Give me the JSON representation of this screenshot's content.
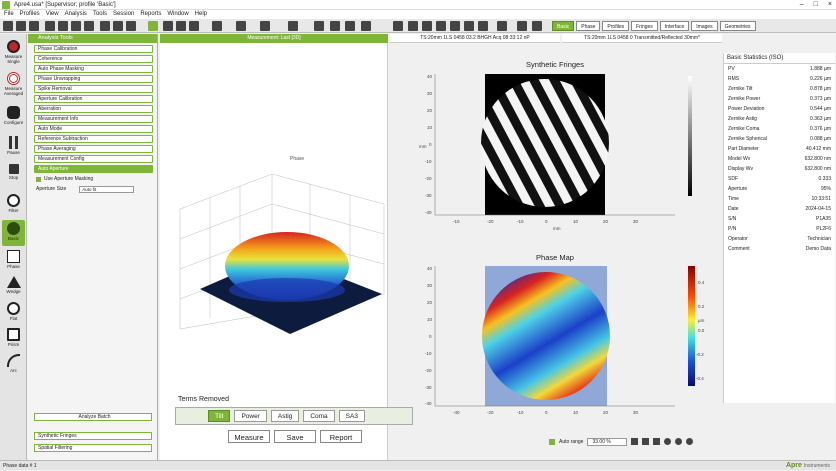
{
  "window": {
    "title": "Apre4.usa* [Supervisor; profile 'Basic']",
    "controls": [
      "–",
      "□",
      "×"
    ]
  },
  "menu": [
    "File",
    "Profiles",
    "View",
    "Analysis",
    "Tools",
    "Session",
    "Reports",
    "Window",
    "Help"
  ],
  "toolbar": {
    "view_tabs": [
      {
        "label": "Basic",
        "active": true
      },
      {
        "label": "Phase",
        "active": false
      },
      {
        "label": "Profiles",
        "active": false
      },
      {
        "label": "Fringes",
        "active": false
      },
      {
        "label": "Interface",
        "active": false
      },
      {
        "label": "Images",
        "active": false
      },
      {
        "label": "Geometries",
        "active": false
      }
    ]
  },
  "left_tools": [
    {
      "label": "Measure Single",
      "icon": "measure-circle-icon"
    },
    {
      "label": "Measure Averaged",
      "icon": "target-icon"
    },
    {
      "label": "Configure",
      "icon": "microphone-icon"
    },
    {
      "label": "Pause",
      "icon": "pause-icon"
    },
    {
      "label": "Stop",
      "icon": "stop-icon"
    },
    {
      "label": "Filter",
      "icon": "filter-wheel-icon"
    },
    {
      "label": "Basic",
      "icon": "basic-icon",
      "active": true
    },
    {
      "label": "Phase",
      "icon": "phase-icon"
    },
    {
      "label": "Wedge",
      "icon": "wedge-icon"
    },
    {
      "label": "Flat",
      "icon": "circle-icon"
    },
    {
      "label": "Prism",
      "icon": "prism-icon"
    },
    {
      "label": "Arc",
      "icon": "arc-icon"
    }
  ],
  "panel": {
    "header": "Analysis Tools",
    "items": [
      "Phase Calibration",
      "Coherence",
      "Auto Phase Masking",
      "Phase Unwrapping",
      "Spike Removal",
      "Aperture Calibration",
      "Aberration",
      "Measurement Info",
      "Auto Mode",
      "Reference Subtraction",
      "Phase Averaging",
      "Measurement Config",
      "Auto Aperture"
    ],
    "selected_index": 12,
    "sub_option": {
      "label": "Use Aperture Masking",
      "field_label": "Aperture Size",
      "field_value": "Auto fit"
    },
    "footer_top": "Analyze Batch",
    "footer_items": [
      "Synthetic Fringes",
      "Spatial Filtering"
    ]
  },
  "plot3d": {
    "tab": "Measurement: Last [3D]",
    "legend": "Phase"
  },
  "terms": {
    "label": "Terms Removed",
    "buttons": [
      "Tilt",
      "Power",
      "Astig",
      "Coma",
      "SA3"
    ],
    "selected": "Tilt"
  },
  "actions": {
    "measure": "Measure",
    "save": "Save",
    "report": "Report"
  },
  "fringes": {
    "header": "TS:20mm 1LS 0458 03.2 BHGH Acq 08:33:12 nP",
    "title": "Synthetic Fringes",
    "y_ticks": [
      "40",
      "30",
      "20",
      "10",
      "0",
      "-10",
      "-20",
      "-30",
      "-40"
    ],
    "x_ticks": [
      "-10",
      "-20",
      "-10",
      "0",
      "10",
      "20",
      "30"
    ],
    "y_label": "mm",
    "x_label": "mm"
  },
  "phase": {
    "header": "TS:20mm 1LS 0458 0 Transmitted/Reflected 30mm*",
    "title": "Phase Map",
    "colorbar_ticks": [
      "0.4",
      "0.2",
      "0.0",
      "-0.2",
      "-0.4"
    ],
    "colorbar_label": "µm",
    "y_ticks": [
      "40",
      "30",
      "20",
      "10",
      "0",
      "-10",
      "-20",
      "-30",
      "-40"
    ],
    "x_ticks": [
      "-40",
      "-20",
      "-10",
      "0",
      "10",
      "20",
      "30"
    ]
  },
  "stats": {
    "title": "Basic Statistics (ISO)",
    "rows": [
      [
        "PV",
        "1.888 µm"
      ],
      [
        "RMS",
        "0.226 µm"
      ],
      [
        "Zernike Tilt",
        "0.878 µm"
      ],
      [
        "Zernike Power",
        "0.373 µm"
      ],
      [
        "Power Deviation",
        "0.544 µm"
      ],
      [
        "Zernike Astig",
        "0.363 µm"
      ],
      [
        "Zernike Coma",
        "0.376 µm"
      ],
      [
        "Zernike Spherical",
        "0.088 µm"
      ],
      [
        "Part Diameter",
        "40.412 mm"
      ],
      [
        "Model Wv",
        "632.800 nm"
      ],
      [
        "Display Wv",
        "632.800 nm"
      ],
      [
        "SDF",
        "0.333"
      ],
      [
        "Aperture",
        "95%"
      ],
      [
        "Time",
        "10:33:51"
      ],
      [
        "Date",
        "2024-04-15"
      ],
      [
        "S/N",
        "P1A35"
      ],
      [
        "P/N",
        "PL2F6"
      ],
      [
        "Operator",
        "Technician"
      ],
      [
        "Comment",
        "Demo Data"
      ]
    ]
  },
  "bottom": {
    "auto_range": "Auto range",
    "range_value": "33.00 %"
  },
  "status": {
    "left": "Phase data  # 1",
    "brand": "Apre",
    "brand_sub": "Instruments"
  },
  "colors": {
    "accent": "#7fb539",
    "phase_bg": "#8fa8d8"
  }
}
